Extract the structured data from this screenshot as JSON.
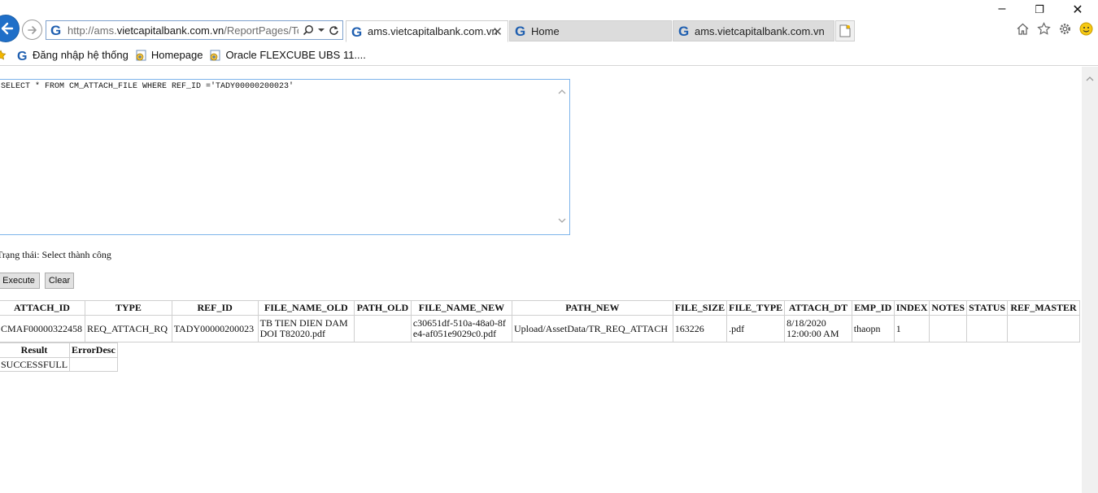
{
  "browser": {
    "address_host": "http://ams.",
    "address_domain": "vietcapitalbank.com.vn",
    "address_path": "/ReportPages/Tools",
    "tabs": [
      {
        "label": "ams.vietcapitalbank.com.vn",
        "active": true
      },
      {
        "label": "Home",
        "active": false
      },
      {
        "label": "ams.vietcapitalbank.com.vn",
        "active": false
      }
    ],
    "favorites": [
      "Đăng nhập hệ thống",
      "Homepage",
      "Oracle FLEXCUBE UBS 11...."
    ]
  },
  "editor": {
    "query": "SELECT * FROM CM_ATTACH_FILE WHERE REF_ID ='TADY00000200023'"
  },
  "status_text": "Trạng thái: Select thành công",
  "buttons": {
    "execute": "Execute",
    "clear": "Clear"
  },
  "data_table": {
    "columns": [
      "ATTACH_ID",
      "TYPE",
      "REF_ID",
      "FILE_NAME_OLD",
      "PATH_OLD",
      "FILE_NAME_NEW",
      "PATH_NEW",
      "FILE_SIZE",
      "FILE_TYPE",
      "ATTACH_DT",
      "EMP_ID",
      "INDEX",
      "NOTES",
      "STATUS",
      "REF_MASTER"
    ],
    "rows": [
      [
        "CMAF00000322458",
        "REQ_ATTACH_RQ",
        "TADY00000200023",
        "TB TIEN DIEN DAM DOI T82020.pdf",
        "",
        "c30651df-510a-48a0-8fe4-af051e9029c0.pdf",
        "Upload/AssetData/TR_REQ_ATTACH",
        "163226",
        ".pdf",
        "8/18/2020 12:00:00 AM",
        "thaopn",
        "1",
        "",
        "",
        ""
      ]
    ]
  },
  "result_table": {
    "columns": [
      "Result",
      "ErrorDesc"
    ],
    "rows": [
      [
        "SUCCESSFULL",
        ""
      ]
    ]
  },
  "colors": {
    "accent": "#1f6fc8",
    "border": "#cfcfcf",
    "focus_border": "#7eb4ea"
  }
}
